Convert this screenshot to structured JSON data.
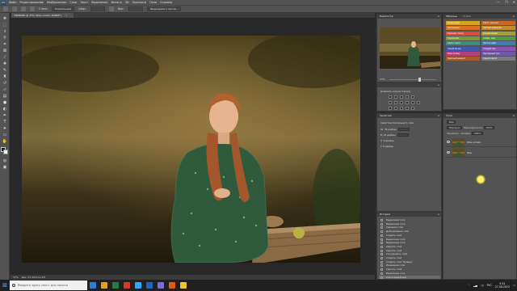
{
  "menubar": {
    "logo": "Ps",
    "items": [
      "Файл",
      "Редактирование",
      "Изображение",
      "Слои",
      "Текст",
      "Выделение",
      "Фильтр",
      "3D",
      "Просмотр",
      "Окно",
      "Справка"
    ],
    "window_controls": [
      "—",
      "❐",
      "✕"
    ]
  },
  "options": {
    "style_label": "Стиль:",
    "style_value": "Нормальный",
    "width_label": "Шир.:",
    "height_label": "Выс.:",
    "refine_label": "Выделение и маска..."
  },
  "document": {
    "tab_title": "TNM6090 @ 37% (Фон копия, RGB/8*)",
    "close_glyph": "×"
  },
  "status": {
    "zoom": "37%",
    "info": "Док: 57,1M/114,2M"
  },
  "navigator": {
    "title": "Навигатор",
    "zoom": "37%"
  },
  "actions": {
    "label": "Добавить корректировку"
  },
  "properties": {
    "title": "Свойства",
    "rows": [
      "Свойства пиксельного слоя",
      "Ш: 36 дюймы",
      "В: 24 дюймы",
      "X: 0 дюймы",
      "Y: 0 дюймы"
    ]
  },
  "history": {
    "title": "История",
    "items": [
      "Выделение слоя",
      "Выделение слоя",
      "Удаление слоя",
      "Дублирование слоя",
      "Создать слой",
      "Выделение слоя",
      "Выделение слоя",
      "Удалить слой",
      "Удалить слой",
      "Скопировать слой",
      "Создать слой",
      "Создать слой \"Кривые\"",
      "Изменение слоя",
      "Удалить слой",
      "Выделение слоя",
      "Снять выделение"
    ],
    "selected_index": 15
  },
  "swatches": {
    "tabs": [
      "Образцы",
      "Стили"
    ],
    "colors": [
      "#d9a21f",
      "#c4682a",
      "#d8741f",
      "#bf8d2c",
      "#df4a3b",
      "#a6a02a",
      "#7a9a3a",
      "#4f9a3c",
      "#3b8f7c",
      "#3b7fb8",
      "#3e58b0",
      "#8a56b6",
      "#b83f7b",
      "#6d5aa8",
      "#a85a2a",
      "#7a7a7a"
    ],
    "names": [
      "Ясная вода",
      "Светл. ватная",
      "Пустынная",
      "Чистый апельсин",
      "Красная глина",
      "Сочная трава",
      "Горчичная",
      "Сладк. мед",
      "Светл. мята",
      "Чистое небо",
      "Синий вечер",
      "Старый лак",
      "Роза холмы",
      "Пурпурный лук",
      "Красный цемент",
      "Серый пепел"
    ]
  },
  "layers": {
    "title": "Слои",
    "kind_label": "Вид",
    "blend": "Обычные",
    "opacity_label": "Непрозрачность:",
    "opacity": "100%",
    "lock_label": "Закрепить:",
    "fill_label": "Заливка:",
    "fill": "100%",
    "rows": [
      {
        "name": "Фон копия",
        "selected": true
      },
      {
        "name": "Фон",
        "selected": false
      }
    ]
  },
  "taskbar": {
    "search_placeholder": "Введите здесь текст для поиска",
    "apps": [
      "#2e7bd6",
      "#e0a020",
      "#2b7a3e",
      "#d33a2c",
      "#31a8ff",
      "#1f66c4",
      "#7b6bd6",
      "#e05a1a",
      "#f2c230"
    ],
    "lang": "РУС",
    "time": "0:41",
    "date": "27.08.2023"
  }
}
